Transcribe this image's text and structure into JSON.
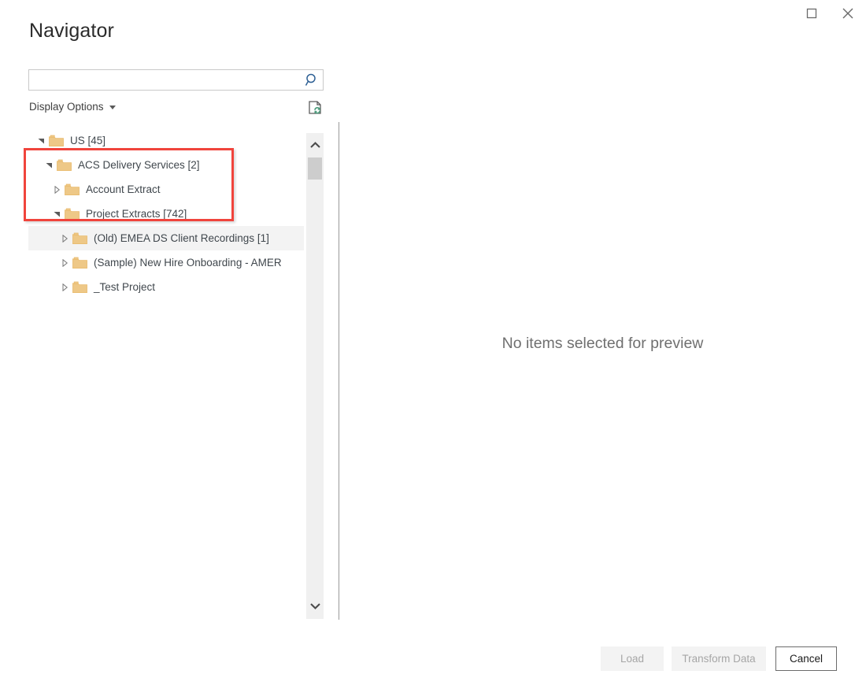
{
  "window": {
    "title": "Navigator",
    "controls": [
      {
        "name": "maximize",
        "icon": "maximize-icon"
      },
      {
        "name": "close",
        "icon": "close-icon"
      }
    ]
  },
  "search": {
    "value": "",
    "placeholder": "",
    "icon": "search-icon"
  },
  "toolbar": {
    "display_options_label": "Display Options",
    "dropdown_icon": "chevron-down-icon",
    "refresh_icon": "refresh-document-icon"
  },
  "tree": {
    "rows": [
      {
        "label": "US [45]",
        "depth": 0,
        "state": "expanded",
        "hover": false
      },
      {
        "label": "ACS Delivery Services [2]",
        "depth": 1,
        "state": "expanded",
        "hover": false
      },
      {
        "label": "Account Extract",
        "depth": 2,
        "state": "collapsed",
        "hover": false
      },
      {
        "label": "Project Extracts [742]",
        "depth": 2,
        "state": "expanded",
        "hover": false
      },
      {
        "label": "(Old) EMEA DS Client Recordings [1]",
        "depth": 3,
        "state": "collapsed",
        "hover": true
      },
      {
        "label": "(Sample) New Hire Onboarding - AMER",
        "depth": 3,
        "state": "collapsed",
        "hover": false
      },
      {
        "label": "_Test Project",
        "depth": 3,
        "state": "collapsed",
        "hover": false
      }
    ],
    "scrollbar": {
      "up_icon": "chevron-up-icon",
      "down_icon": "chevron-down-icon"
    }
  },
  "preview": {
    "empty_message": "No items selected for preview"
  },
  "footer": {
    "load_label": "Load",
    "load_enabled": false,
    "transform_label": "Transform Data",
    "transform_enabled": false,
    "cancel_label": "Cancel",
    "cancel_enabled": true
  },
  "annotation": {
    "color": "#f0443c",
    "highlights": [
      "ACS Delivery Services [2]",
      "Account Extract",
      "Project Extracts [742]"
    ]
  },
  "colors": {
    "folder": "#eec887",
    "folder_edge": "#e8b96a",
    "accent_blue": "#2f6195",
    "text": "#40474d",
    "annotation_red": "#f0443c"
  }
}
